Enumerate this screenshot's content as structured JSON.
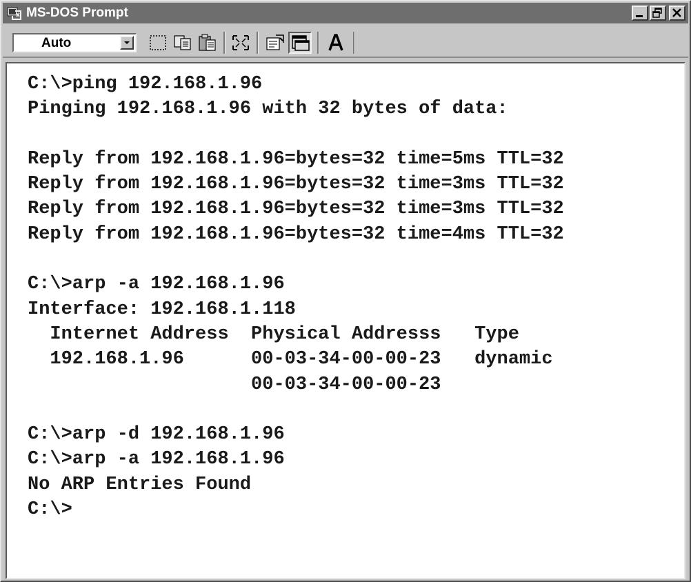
{
  "window": {
    "title": "MS-DOS Prompt",
    "icon": "ms-dos-icon"
  },
  "title_buttons": [
    {
      "name": "minimize-button",
      "icon": "minimize-icon"
    },
    {
      "name": "restore-button",
      "icon": "restore-icon"
    },
    {
      "name": "close-button",
      "icon": "close-icon"
    }
  ],
  "toolbar": {
    "font_size_value": "Auto",
    "buttons": [
      {
        "name": "mark-button",
        "icon": "mark-icon"
      },
      {
        "name": "copy-button",
        "icon": "copy-icon"
      },
      {
        "name": "paste-button",
        "icon": "paste-icon"
      },
      {
        "name": "full-screen-button",
        "icon": "full-screen-icon"
      },
      {
        "name": "properties-button",
        "icon": "properties-icon"
      },
      {
        "name": "background-button",
        "icon": "background-icon"
      },
      {
        "name": "font-button",
        "icon": "font-icon"
      }
    ]
  },
  "terminal": {
    "lines": [
      "C:\\>ping 192.168.1.96",
      "Pinging 192.168.1.96 with 32 bytes of data:",
      "",
      "Reply from 192.168.1.96=bytes=32 time=5ms TTL=32",
      "Reply from 192.168.1.96=bytes=32 time=3ms TTL=32",
      "Reply from 192.168.1.96=bytes=32 time=3ms TTL=32",
      "Reply from 192.168.1.96=bytes=32 time=4ms TTL=32",
      "",
      "C:\\>arp -a 192.168.1.96",
      "Interface: 192.168.1.118",
      "  Internet Address  Physical Addresss   Type",
      "  192.168.1.96      00-03-34-00-00-23   dynamic",
      "                    00-03-34-00-00-23",
      "",
      "C:\\>arp -d 192.168.1.96",
      "C:\\>arp -a 192.168.1.96",
      "No ARP Entries Found",
      "C:\\>"
    ]
  },
  "colors": {
    "titlebar": "#6e6e6e",
    "chrome": "#c6c6c6",
    "terminal_bg": "#ffffff",
    "terminal_text": "#1a1a1a"
  }
}
